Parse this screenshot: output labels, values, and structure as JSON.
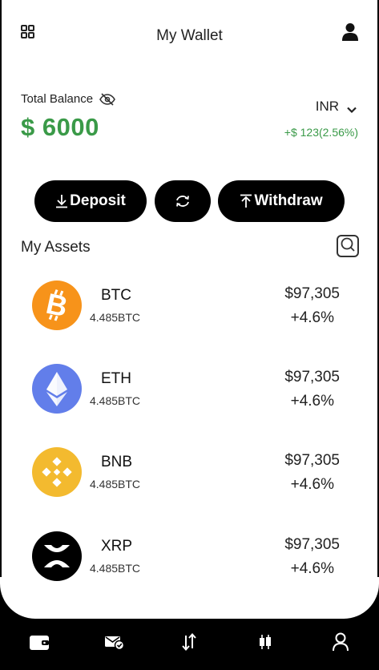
{
  "header": {
    "title": "My Wallet",
    "menu_icon": "grid-icon",
    "profile_icon": "user-icon"
  },
  "balance": {
    "label": "Total Balance",
    "amount": "$ 6000",
    "currency": "INR",
    "change": "+$ 123(2.56%)",
    "accent_color": "#3a9a48"
  },
  "actions": {
    "deposit_label": "Deposit",
    "withdraw_label": "Withdraw",
    "swap_icon": "refresh-icon"
  },
  "assets": {
    "title": "My Assets",
    "items": [
      {
        "symbol": "BTC",
        "quantity": "4.485BTC",
        "price": "$97,305",
        "change": "+4.6%",
        "color": "#f7931a"
      },
      {
        "symbol": "ETH",
        "quantity": "4.485BTC",
        "price": "$97,305",
        "change": "+4.6%",
        "color": "#627eea"
      },
      {
        "symbol": "BNB",
        "quantity": "4.485BTC",
        "price": "$97,305",
        "change": "+4.6%",
        "color": "#f3ba2f"
      },
      {
        "symbol": "XRP",
        "quantity": "4.485BTC",
        "price": "$97,305",
        "change": "+4.6%",
        "color": "#000000"
      }
    ]
  },
  "bottom_nav": [
    "wallet-icon",
    "mail-check-icon",
    "transfer-icon",
    "candlestick-icon",
    "profile-icon"
  ]
}
